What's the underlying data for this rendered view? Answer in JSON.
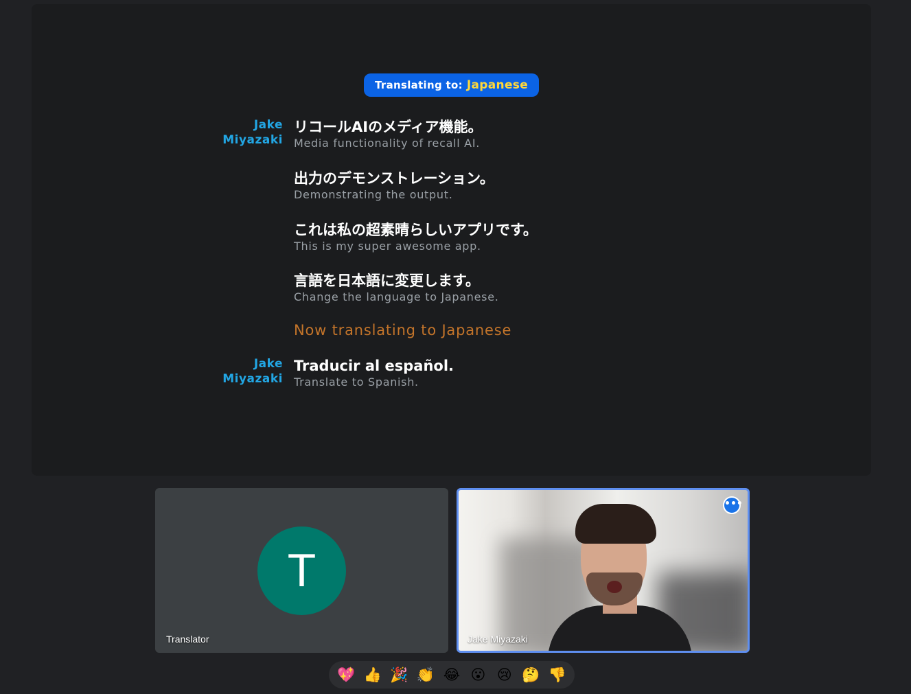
{
  "caption_panel": {
    "language_prefix": "Translating to:",
    "language_name": "Japanese",
    "entries": [
      {
        "speaker_first": "Jake",
        "speaker_last": "Miyazaki",
        "text": "リコールAIのメディア機能。",
        "translation": "Media functionality of recall AI."
      },
      {
        "speaker_first": "",
        "speaker_last": "",
        "text": "出力のデモンストレーション。",
        "translation": "Demonstrating the output."
      },
      {
        "speaker_first": "",
        "speaker_last": "",
        "text": "これは私の超素晴らしいアプリです。",
        "translation": "This is my super awesome app."
      },
      {
        "speaker_first": "",
        "speaker_last": "",
        "text": "言語を日本語に変更します。",
        "translation": "Change the language to Japanese."
      },
      {
        "speaker_first": "Jake",
        "speaker_last": "Miyazaki",
        "text": "Traducir al español.",
        "translation": "Translate to Spanish."
      }
    ],
    "notice": "Now translating to Japanese"
  },
  "participants": {
    "translator": {
      "name": "Translator",
      "initial": "T",
      "avatar_color": "#00796b"
    },
    "speaker": {
      "name": "Jake Miyazaki",
      "more_icon": "more-options-icon",
      "highlight_color": "#5f8ff0"
    }
  },
  "reactions": [
    {
      "icon": "sparkling-heart-icon",
      "glyph": "💖"
    },
    {
      "icon": "thumbs-up-icon",
      "glyph": "👍"
    },
    {
      "icon": "party-popper-icon",
      "glyph": "🎉"
    },
    {
      "icon": "clapping-hands-icon",
      "glyph": "👏"
    },
    {
      "icon": "tears-of-joy-icon",
      "glyph": "😂"
    },
    {
      "icon": "surprised-face-icon",
      "glyph": "😮"
    },
    {
      "icon": "crying-face-icon",
      "glyph": "😢"
    },
    {
      "icon": "thinking-face-icon",
      "glyph": "🤔"
    },
    {
      "icon": "thumbs-down-icon",
      "glyph": "👎"
    }
  ]
}
